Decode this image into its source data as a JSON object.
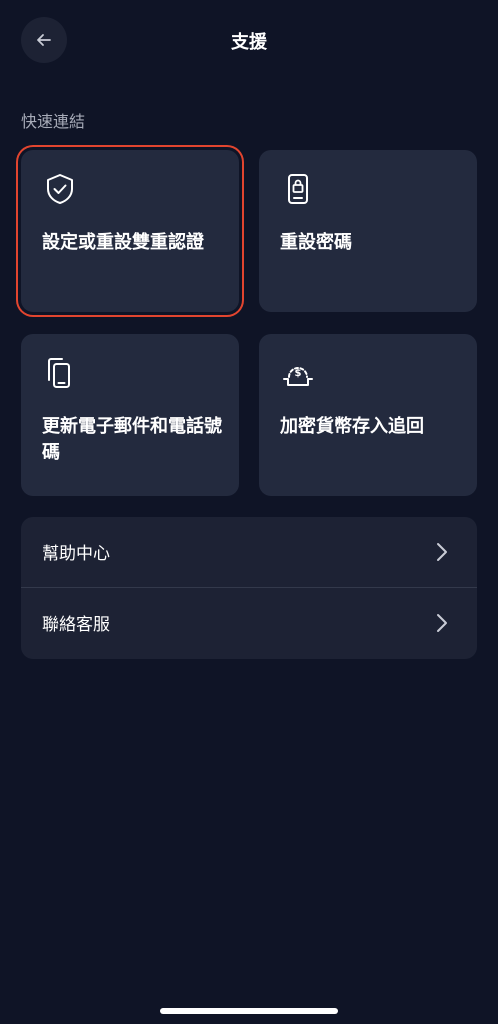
{
  "header": {
    "title": "支援",
    "back_icon": "arrow-left-icon"
  },
  "quick_links": {
    "section_label": "快速連結",
    "cards": [
      {
        "label": "設定或重設雙重認證",
        "icon": "shield-check-icon",
        "selected": true
      },
      {
        "label": "重設密碼",
        "icon": "phone-lock-icon",
        "selected": false
      },
      {
        "label": "更新電子郵件和電話號碼",
        "icon": "copy-phone-icon",
        "selected": false
      },
      {
        "label": "加密貨幣存入追回",
        "icon": "dollar-deposit-icon",
        "selected": false
      }
    ]
  },
  "list": {
    "items": [
      {
        "label": "幫助中心",
        "icon": "chevron-right-icon"
      },
      {
        "label": "聯絡客服",
        "icon": "chevron-right-icon"
      }
    ]
  },
  "colors": {
    "background": "#0f1426",
    "card": "#232a3e",
    "selection_outline": "#e2452f",
    "muted_text": "#a7abb8"
  }
}
